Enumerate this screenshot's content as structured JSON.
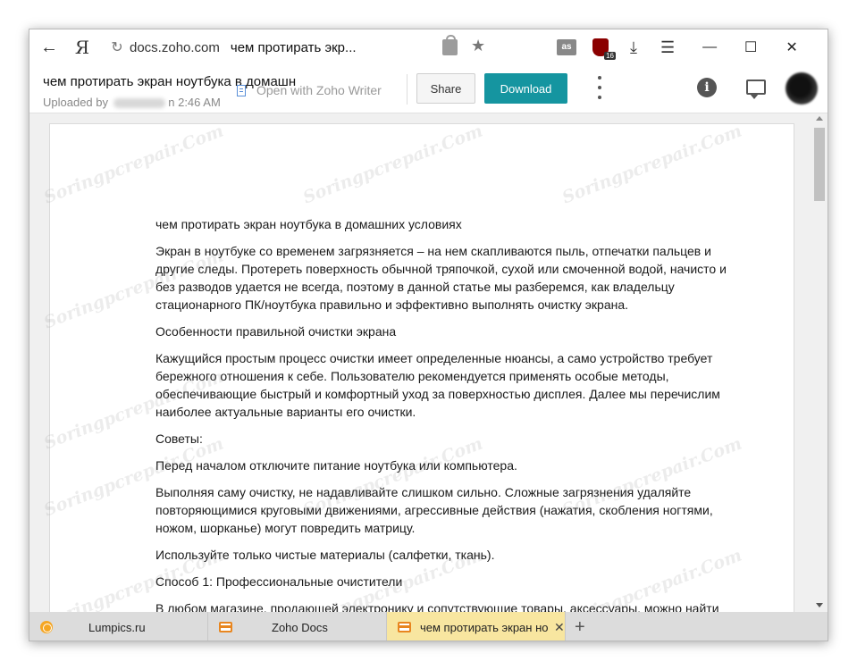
{
  "browser": {
    "url_domain": "docs.zoho.com",
    "url_title": "чем протирать экр...",
    "logo": "Я",
    "ext_lastfm": "as",
    "ext_ublock_count": "16"
  },
  "zoho": {
    "doc_title": "чем протирать экран ноутбука в домашн",
    "uploaded_prefix": "Uploaded by",
    "uploaded_time": "n 2:46 AM",
    "open_with": "Open with Zoho Writer",
    "share_label": "Share",
    "download_label": "Download",
    "info_glyph": "i"
  },
  "document": {
    "paragraphs": [
      "чем протирать экран ноутбука в домашних условиях",
      "Экран в ноутбуке со временем загрязняется – на нем скапливаются пыль, отпечатки пальцев и другие следы. Протереть поверхность обычной тряпочкой, сухой или смоченной водой, начисто и без разводов удается не всегда, поэтому в данной статье мы разберемся, как владельцу стационарного ПК/ноутбука правильно и эффективно выполнять очистку экрана.",
      "Особенности правильной очистки экрана",
      "Кажущийся простым процесс очистки имеет определенные нюансы, а само устройство требует бережного отношения к себе. Пользователю рекомендуется применять особые методы, обеспечивающие быстрый и комфортный уход за поверхностью дисплея. Далее мы перечислим наиболее актуальные варианты его очистки.",
      "Советы:",
      "Перед началом отключите питание ноутбука или компьютера.",
      "Выполняя саму очистку, не надавливайте слишком сильно. Сложные загрязнения удаляйте повторяющимися круговыми движениями, агрессивные действия (нажатия, скобления ногтями, ножом, шорканье) могут повредить матрицу.",
      "Используйте только чистые материалы (салфетки, ткань).",
      "Способ 1: Профессиональные очистители",
      "В любом магазине, продающей электронику и сопутствующие товары, аксессуары, можно найти"
    ],
    "watermark": "Soringpcrepair.Com"
  },
  "tabs": [
    {
      "label": "Lumpics.ru",
      "icon": "lumpics-favicon-icon"
    },
    {
      "label": "Zoho Docs",
      "icon": "folder-favicon-icon"
    },
    {
      "label": "чем протирать экран но",
      "icon": "folder-favicon-icon"
    }
  ]
}
